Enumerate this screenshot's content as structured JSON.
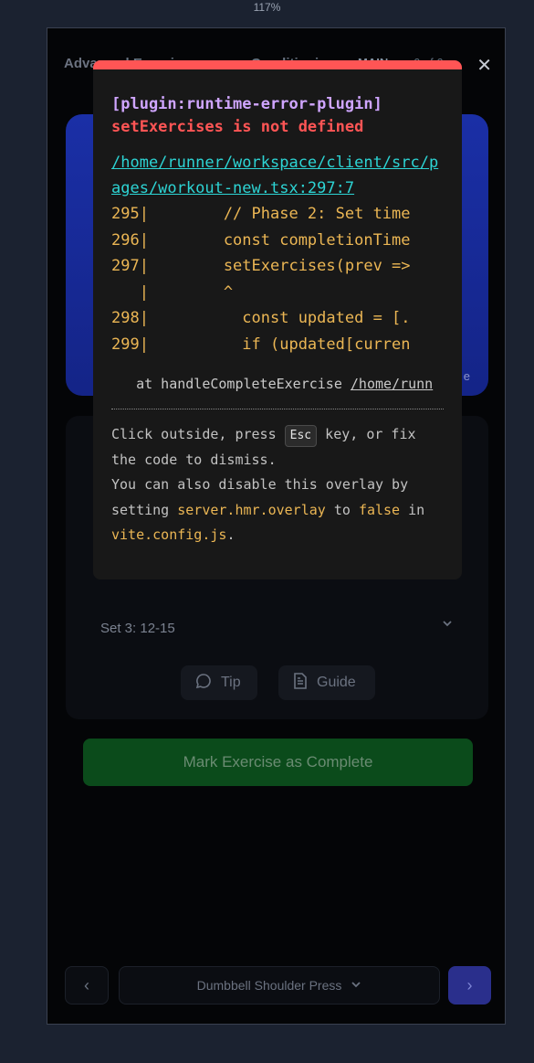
{
  "browser": {
    "zoom": "117%"
  },
  "header": {
    "title": "Advanced Exercises",
    "title2": "Conditioning",
    "phase": "MAIN",
    "counter": "6 of 6"
  },
  "hero": {
    "corner_label": "e"
  },
  "card": {
    "set_label": "Set 3: 12-15",
    "tip_label": "Tip",
    "guide_label": "Guide"
  },
  "actions": {
    "complete_label": "Mark Exercise as Complete"
  },
  "bottom_nav": {
    "exercise_name": "Dumbbell Shoulder Press"
  },
  "error_overlay": {
    "plugin": "[plugin:runtime-error-plugin]",
    "message": "setExercises is not defined",
    "file": "/home/runner/workspace/client/src/pages/workout-new.tsx:297:7",
    "code_lines": [
      "295|        // Phase 2: Set time",
      "296|        const completionTime",
      "297|        setExercises(prev =>",
      "   |        ^",
      "298|          const updated = [.",
      "299|          if (updated[curren"
    ],
    "stack_prefix": "at handleCompleteExercise ",
    "stack_path": "/home/runn",
    "tip_part1": "Click outside, press ",
    "tip_key": "Esc",
    "tip_part2": " key, or fix the code to dismiss.",
    "tip_part3": "You can also disable this overlay by setting ",
    "tip_setting": "server.hmr.overlay",
    "tip_part4": " to ",
    "tip_false": "false",
    "tip_part5": " in ",
    "tip_config": "vite.config.js",
    "tip_part6": "."
  },
  "colors": {
    "error_border": "#ff5555",
    "plugin": "#cfa5ff",
    "link": "#2dd4d4",
    "code": "#ebb654",
    "complete_button": "#0b4b1b",
    "next_button": "#2a2f8c"
  }
}
